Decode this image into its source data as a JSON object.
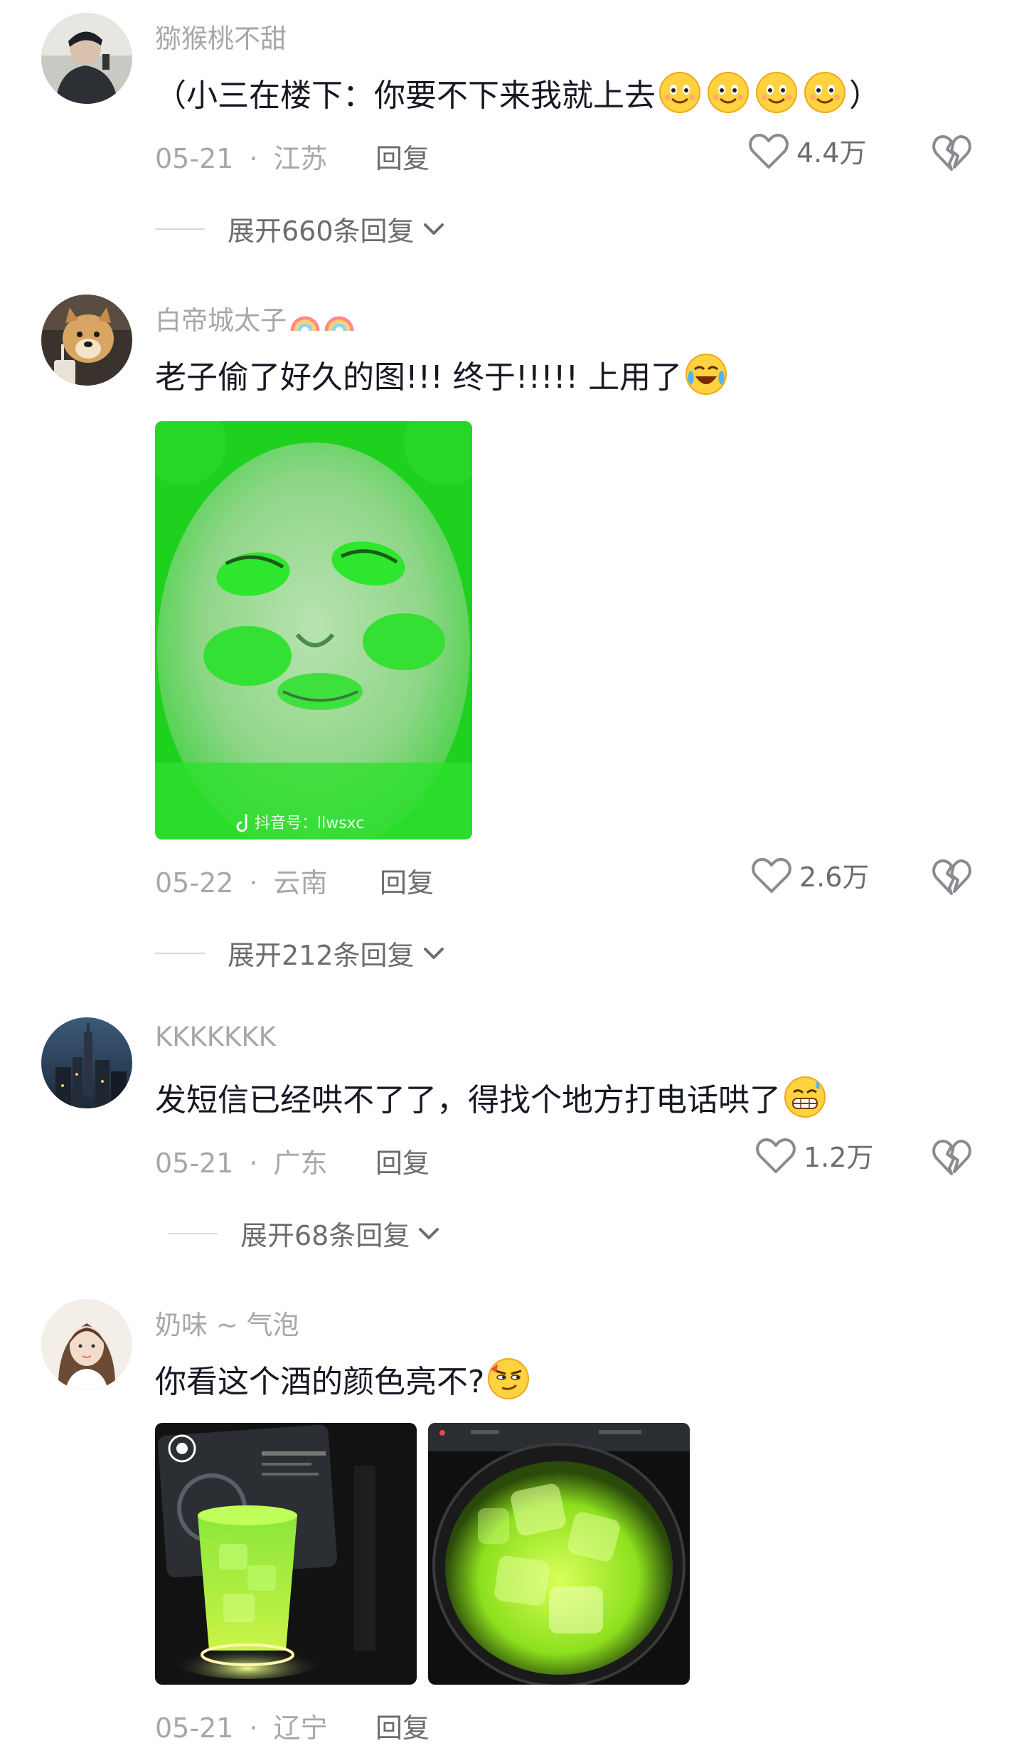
{
  "comments": [
    {
      "username": "猕猴桃不甜",
      "text": "（小三在楼下：你要不下来我就上去",
      "text_end": "）",
      "emojis": [
        "smile-emoji",
        "smile-emoji",
        "smile-emoji",
        "smile-emoji"
      ],
      "date": "05-21",
      "location": "江苏",
      "reply_label": "回复",
      "likes": "4.4万",
      "expand_label": "展开660条回复"
    },
    {
      "username": "白帝城太子",
      "badges": [
        "rainbow-icon",
        "rainbow-icon"
      ],
      "text": "老子偷了好久的图!!! 终于!!!!! 上用了",
      "emojis": [
        "crying-laugh-emoji"
      ],
      "image_watermark": "抖音号：llwsxc",
      "date": "05-22",
      "location": "云南",
      "reply_label": "回复",
      "likes": "2.6万",
      "expand_label": "展开212条回复"
    },
    {
      "username": "KKKKKKK",
      "text": "发短信已经哄不了了，得找个地方打电话哄了",
      "emojis": [
        "grin-sweat-emoji"
      ],
      "date": "05-21",
      "location": "广东",
      "reply_label": "回复",
      "likes": "1.2万",
      "expand_label": "展开68条回复"
    },
    {
      "username": "奶味 ~ 气泡",
      "text": "你看这个酒的颜色亮不?",
      "emojis": [
        "smirk-emoji"
      ],
      "date": "05-21",
      "location": "辽宁",
      "reply_label": "回复"
    }
  ],
  "colors": {
    "username": "#a6a7ab",
    "body_text": "#161823",
    "meta_text": "#a6a7ab",
    "action_text": "#6b6c70",
    "neon_green": "#39e639",
    "emoji_yellow": "#ffd23f"
  }
}
